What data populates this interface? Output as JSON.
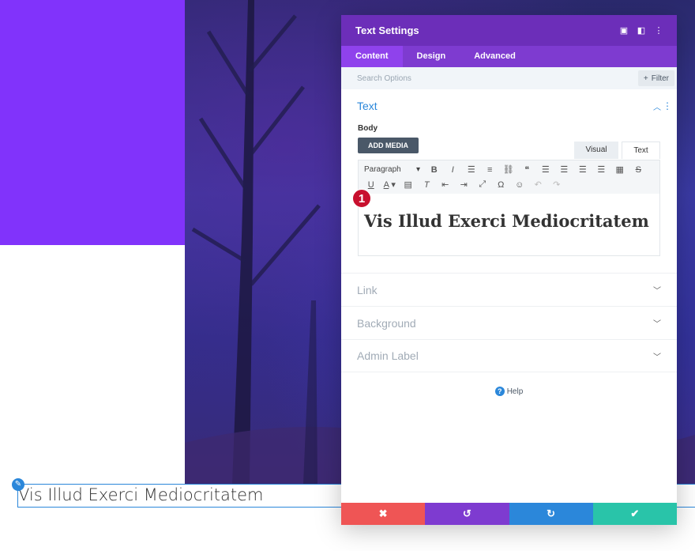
{
  "background": {
    "accent": "#8133fb"
  },
  "page": {
    "module_text": "Vis Illud Exerci Mediocritatem",
    "edit_icon": "pencil-icon"
  },
  "modal": {
    "title": "Text Settings",
    "header_icons": [
      "fullscreen-icon",
      "split-view-icon",
      "more-vertical-icon"
    ],
    "tabs": [
      {
        "label": "Content",
        "active": true
      },
      {
        "label": "Design",
        "active": false
      },
      {
        "label": "Advanced",
        "active": false
      }
    ],
    "search": {
      "placeholder": "Search Options"
    },
    "filter_label": "Filter",
    "text_section": {
      "title": "Text",
      "body_label": "Body",
      "add_media_label": "ADD MEDIA",
      "mode_visual": "Visual",
      "mode_text": "Text",
      "paragraph_select": "Paragraph",
      "heading": "Vis Illud Exerci Mediocritatem",
      "marker": "1"
    },
    "sections": [
      "Link",
      "Background",
      "Admin Label"
    ],
    "help_label": "Help",
    "colors": {
      "header": "#6c2eb9",
      "tabs": "#7e3bd0",
      "cancel": "#ef5555",
      "undo": "#7e3bd0",
      "redo": "#2b87da",
      "save": "#29c4a9"
    }
  }
}
